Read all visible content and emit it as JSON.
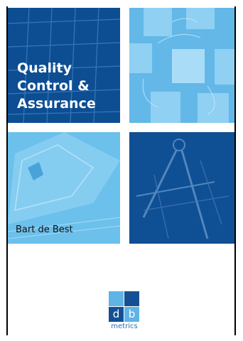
{
  "cover": {
    "title_lines": [
      "Quality",
      "Control &",
      "Assurance"
    ],
    "author": "Bart de Best"
  },
  "logo": {
    "letter_left": "d",
    "letter_right": "b",
    "caption": "metrics"
  },
  "colors": {
    "dark_blue": "#0d4d92",
    "light_blue": "#63b8e8"
  },
  "icons": [
    "grid-pattern",
    "process-diagram",
    "set-square",
    "compass"
  ]
}
